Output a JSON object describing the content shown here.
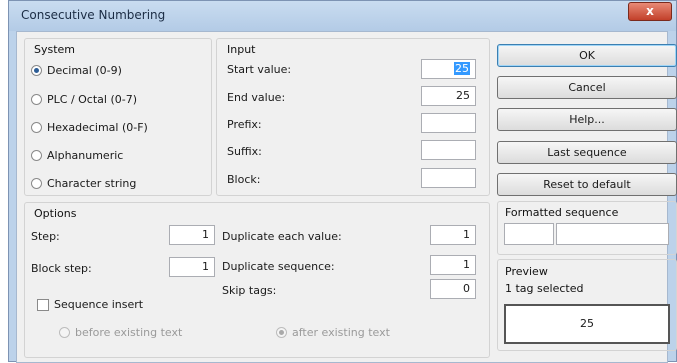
{
  "window": {
    "title": "Consecutive Numbering",
    "close_glyph": "x"
  },
  "system": {
    "label": "System",
    "options": [
      {
        "label": "Decimal (0-9)",
        "selected": true
      },
      {
        "label": "PLC / Octal (0-7)",
        "selected": false
      },
      {
        "label": "Hexadecimal (0-F)",
        "selected": false
      },
      {
        "label": "Alphanumeric",
        "selected": false
      },
      {
        "label": "Character string",
        "selected": false
      }
    ]
  },
  "input": {
    "label": "Input",
    "start_label": "Start value:",
    "start_value": "25",
    "end_label": "End value:",
    "end_value": "25",
    "prefix_label": "Prefix:",
    "prefix_value": "",
    "suffix_label": "Suffix:",
    "suffix_value": "",
    "block_label": "Block:",
    "block_value": ""
  },
  "options": {
    "label": "Options",
    "step_label": "Step:",
    "step_value": "1",
    "block_step_label": "Block step:",
    "block_step_value": "1",
    "dup_each_label": "Duplicate each value:",
    "dup_each_value": "1",
    "dup_seq_label": "Duplicate sequence:",
    "dup_seq_value": "1",
    "skip_label": "Skip tags:",
    "skip_value": "0",
    "seq_insert_label": "Sequence insert",
    "seq_insert_checked": false,
    "before_label": "before existing text",
    "after_label": "after existing text"
  },
  "buttons": {
    "ok": "OK",
    "cancel": "Cancel",
    "help": "Help...",
    "last_sequence": "Last sequence",
    "reset": "Reset to default"
  },
  "formatted": {
    "label": "Formatted sequence"
  },
  "preview": {
    "label": "Preview",
    "selection": "1 tag selected",
    "value": "25"
  },
  "colors": {
    "title_bar": "#bcd2ea",
    "close_button": "#c2402a",
    "selection": "#3399ff"
  }
}
